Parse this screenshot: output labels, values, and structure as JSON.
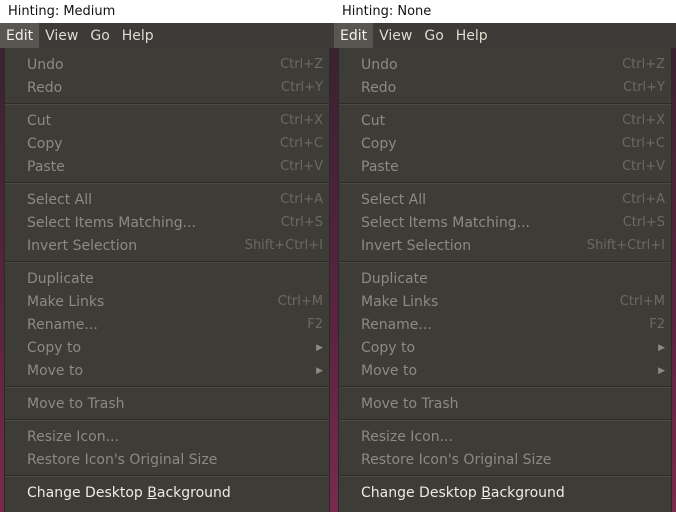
{
  "panels": [
    {
      "caption": "Hinting: Medium",
      "menubar": [
        "Edit",
        "View",
        "Go",
        "Help"
      ],
      "groups": [
        [
          {
            "label": "Undo",
            "accel": "Ctrl+Z"
          },
          {
            "label": "Redo",
            "accel": "Ctrl+Y"
          }
        ],
        [
          {
            "label": "Cut",
            "accel": "Ctrl+X"
          },
          {
            "label": "Copy",
            "accel": "Ctrl+C"
          },
          {
            "label": "Paste",
            "accel": "Ctrl+V"
          }
        ],
        [
          {
            "label": "Select All",
            "accel": "Ctrl+A"
          },
          {
            "label": "Select Items Matching...",
            "accel": "Ctrl+S"
          },
          {
            "label": "Invert Selection",
            "accel": "Shift+Ctrl+I"
          }
        ],
        [
          {
            "label": "Duplicate",
            "accel": ""
          },
          {
            "label": "Make Links",
            "accel": "Ctrl+M"
          },
          {
            "label": "Rename...",
            "accel": "F2"
          },
          {
            "label": "Copy to",
            "submenu": true
          },
          {
            "label": "Move to",
            "submenu": true
          }
        ],
        [
          {
            "label": "Move to Trash",
            "accel": ""
          }
        ],
        [
          {
            "label": "Resize Icon...",
            "accel": ""
          },
          {
            "label": "Restore Icon's Original Size",
            "accel": ""
          }
        ],
        [
          {
            "label_parts": [
              "Change Desktop ",
              "B",
              "ackground"
            ],
            "enabled": true
          }
        ]
      ]
    },
    {
      "caption": "Hinting: None",
      "menubar": [
        "Edit",
        "View",
        "Go",
        "Help"
      ],
      "groups": [
        [
          {
            "label": "Undo",
            "accel": "Ctrl+Z"
          },
          {
            "label": "Redo",
            "accel": "Ctrl+Y"
          }
        ],
        [
          {
            "label": "Cut",
            "accel": "Ctrl+X"
          },
          {
            "label": "Copy",
            "accel": "Ctrl+C"
          },
          {
            "label": "Paste",
            "accel": "Ctrl+V"
          }
        ],
        [
          {
            "label": "Select All",
            "accel": "Ctrl+A"
          },
          {
            "label": "Select Items Matching...",
            "accel": "Ctrl+S"
          },
          {
            "label": "Invert Selection",
            "accel": "Shift+Ctrl+I"
          }
        ],
        [
          {
            "label": "Duplicate",
            "accel": ""
          },
          {
            "label": "Make Links",
            "accel": "Ctrl+M"
          },
          {
            "label": "Rename...",
            "accel": "F2"
          },
          {
            "label": "Copy to",
            "submenu": true
          },
          {
            "label": "Move to",
            "submenu": true
          }
        ],
        [
          {
            "label": "Move to Trash",
            "accel": ""
          }
        ],
        [
          {
            "label": "Resize Icon...",
            "accel": ""
          },
          {
            "label": "Restore Icon's Original Size",
            "accel": ""
          }
        ],
        [
          {
            "label_parts": [
              "Change Desktop ",
              "B",
              "ackground"
            ],
            "enabled": true
          }
        ]
      ]
    }
  ],
  "icons": {
    "submenu_arrow": "triangle-right-icon"
  }
}
